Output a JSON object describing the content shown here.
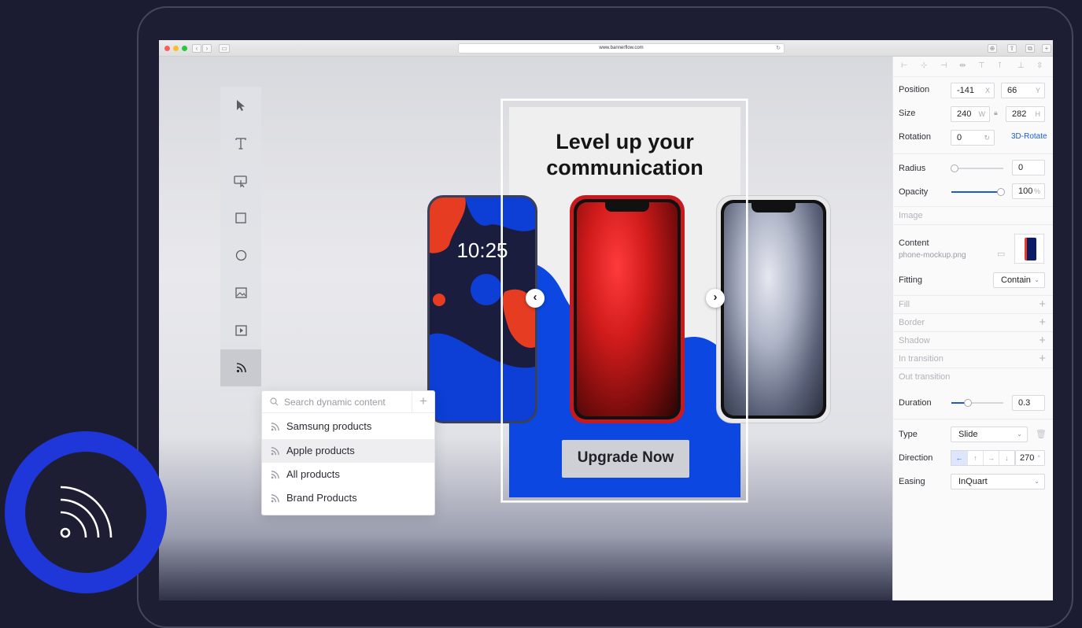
{
  "browser": {
    "url": "www.bannerflow.com"
  },
  "tools": [
    {
      "name": "select-tool",
      "icon": "cursor-icon"
    },
    {
      "name": "text-tool",
      "icon": "text-icon"
    },
    {
      "name": "widget-tool",
      "icon": "widget-icon"
    },
    {
      "name": "rectangle-tool",
      "icon": "rectangle-icon"
    },
    {
      "name": "ellipse-tool",
      "icon": "ellipse-icon"
    },
    {
      "name": "image-tool",
      "icon": "image-icon"
    },
    {
      "name": "video-tool",
      "icon": "video-icon"
    },
    {
      "name": "feed-tool",
      "icon": "rss-icon",
      "active": true
    }
  ],
  "dynamic_content": {
    "search_placeholder": "Search dynamic content",
    "items": [
      "Samsung products",
      "Apple products",
      "All products",
      "Brand Products"
    ],
    "highlighted_index": 1
  },
  "banner": {
    "headline": "Level up your communication",
    "time": "10:25",
    "cta": "Upgrade Now",
    "accent": "#0b47e0"
  },
  "properties": {
    "position_label": "Position",
    "position_x": "-141",
    "position_x_unit": "X",
    "position_y": "66",
    "position_y_unit": "Y",
    "size_label": "Size",
    "size_w": "240",
    "size_w_unit": "W",
    "size_h": "282",
    "size_h_unit": "H",
    "rotation_label": "Rotation",
    "rotation": "0",
    "rotate3d_link": "3D-Rotate",
    "radius_label": "Radius",
    "radius": "0",
    "opacity_label": "Opacity",
    "opacity": "100",
    "opacity_unit": "%",
    "image_section": "Image",
    "content_label": "Content",
    "content_file": "phone-mockup.png",
    "fitting_label": "Fitting",
    "fitting": "Contain",
    "sections": [
      "Fill",
      "Border",
      "Shadow",
      "In transition",
      "Out transition"
    ],
    "duration_label": "Duration",
    "duration": "0.3",
    "type_label": "Type",
    "type": "Slide",
    "direction_label": "Direction",
    "direction": "270",
    "direction_unit": "°",
    "easing_label": "Easing",
    "easing": "InQuart"
  }
}
